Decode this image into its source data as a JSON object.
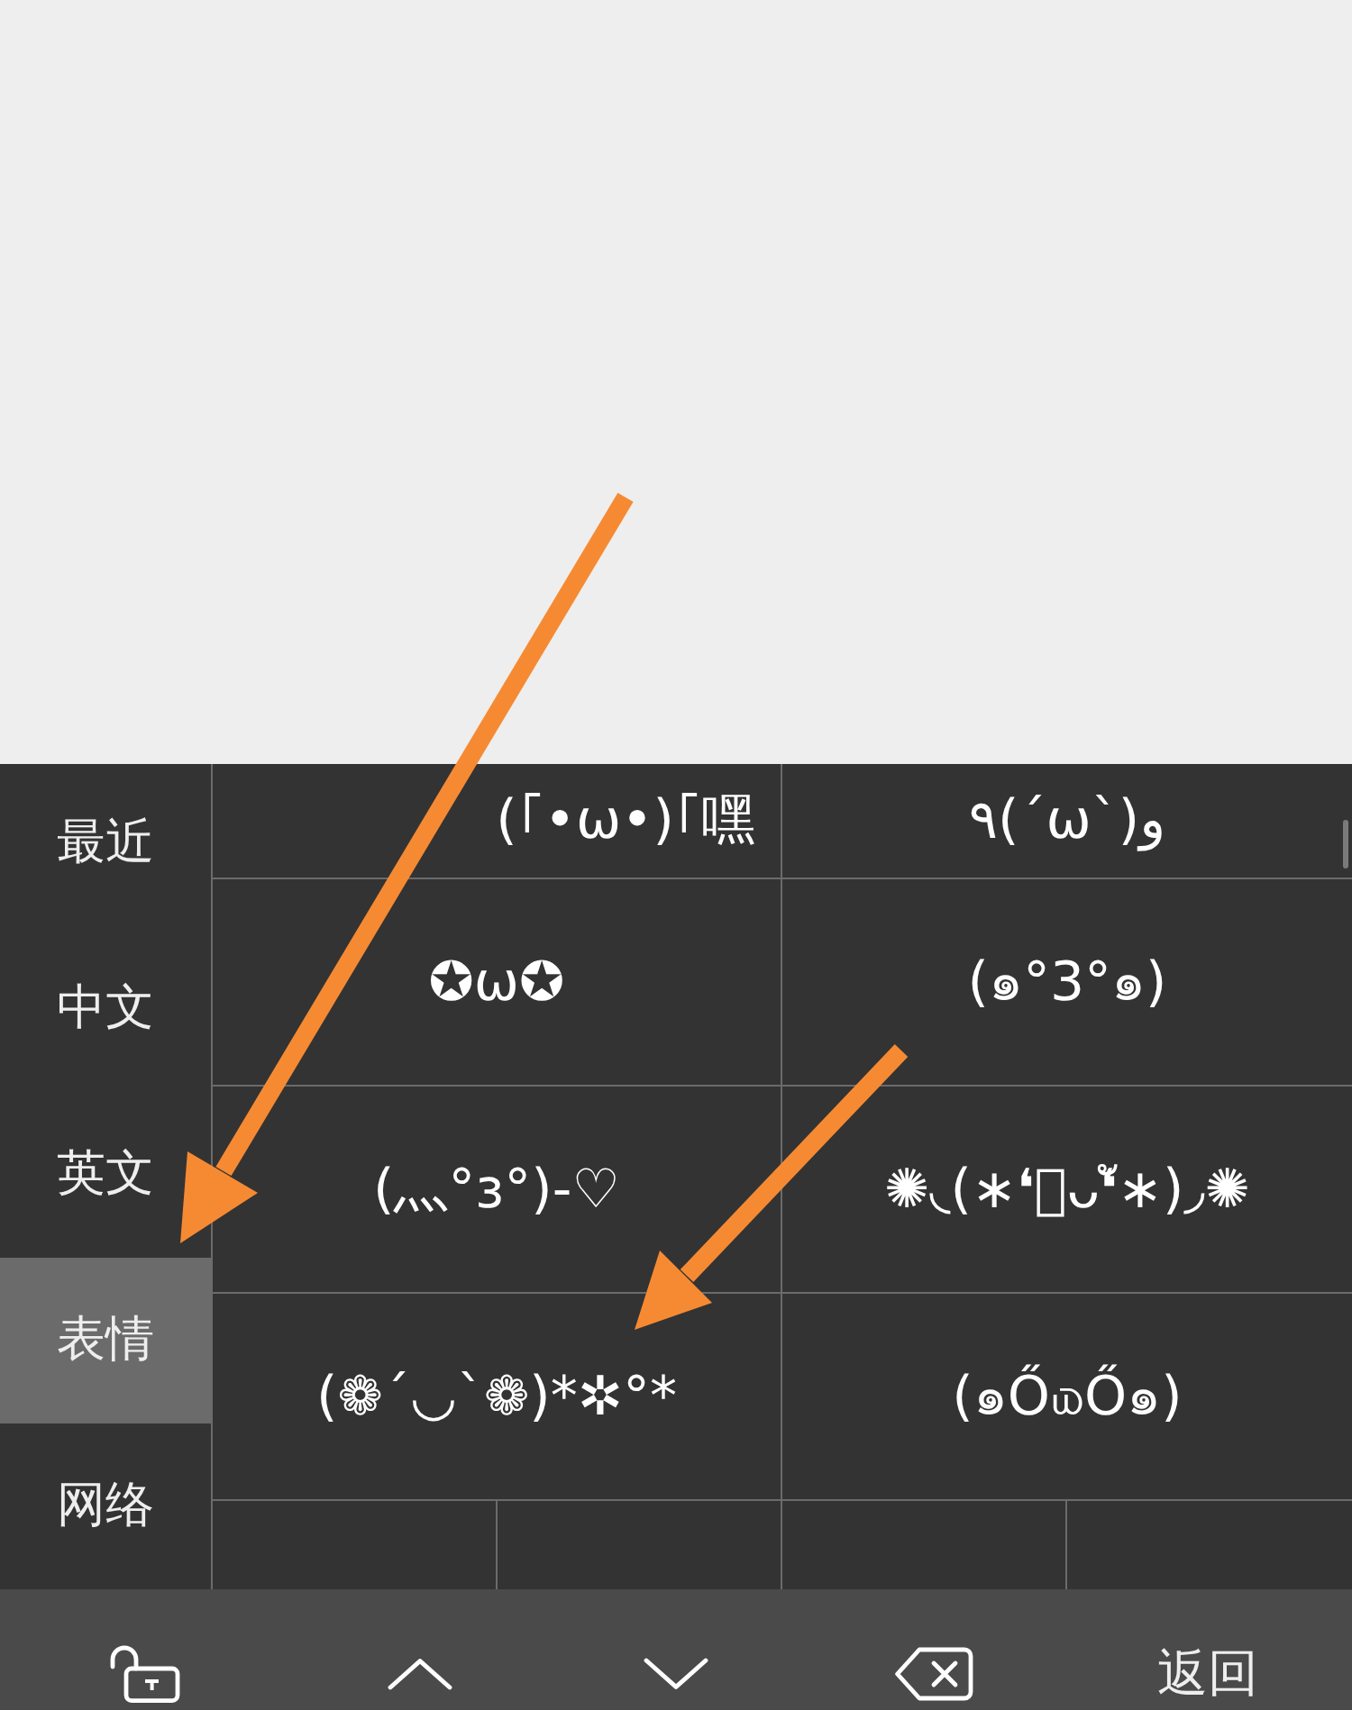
{
  "sidebar": {
    "items": [
      {
        "label": "最近",
        "selected": false
      },
      {
        "label": "中文",
        "selected": false
      },
      {
        "label": "英文",
        "selected": false
      },
      {
        "label": "表情",
        "selected": true
      },
      {
        "label": "网络",
        "selected": false
      }
    ]
  },
  "emoticon_grid": {
    "rows": [
      {
        "cells": [
          "(｢•ω•)｢嘿",
          "٩(ˊωˋ)و"
        ]
      },
      {
        "cells": [
          "✪ω✪",
          "(๑°3°๑)"
        ]
      },
      {
        "cells": [
          "(灬°з°)-♡",
          "✺◟(∗❛ัᴗ❛ั∗)◞✺"
        ]
      },
      {
        "cells": [
          "(❁´◡`❁)*✲°*",
          "(๑Ő௰Ő๑)"
        ]
      }
    ],
    "cut_row": [
      {
        "kind": "cut"
      },
      {
        "kind": "cut"
      },
      {
        "kind": "cut"
      },
      {
        "kind": "cut"
      }
    ]
  },
  "toolbar": {
    "buttons": [
      {
        "kind": "lock"
      },
      {
        "kind": "up"
      },
      {
        "kind": "down"
      },
      {
        "kind": "backspace"
      },
      {
        "kind": "text",
        "label": "返回"
      }
    ]
  },
  "annotations": [
    {
      "kind": "arrow"
    },
    {
      "kind": "arrow"
    }
  ]
}
